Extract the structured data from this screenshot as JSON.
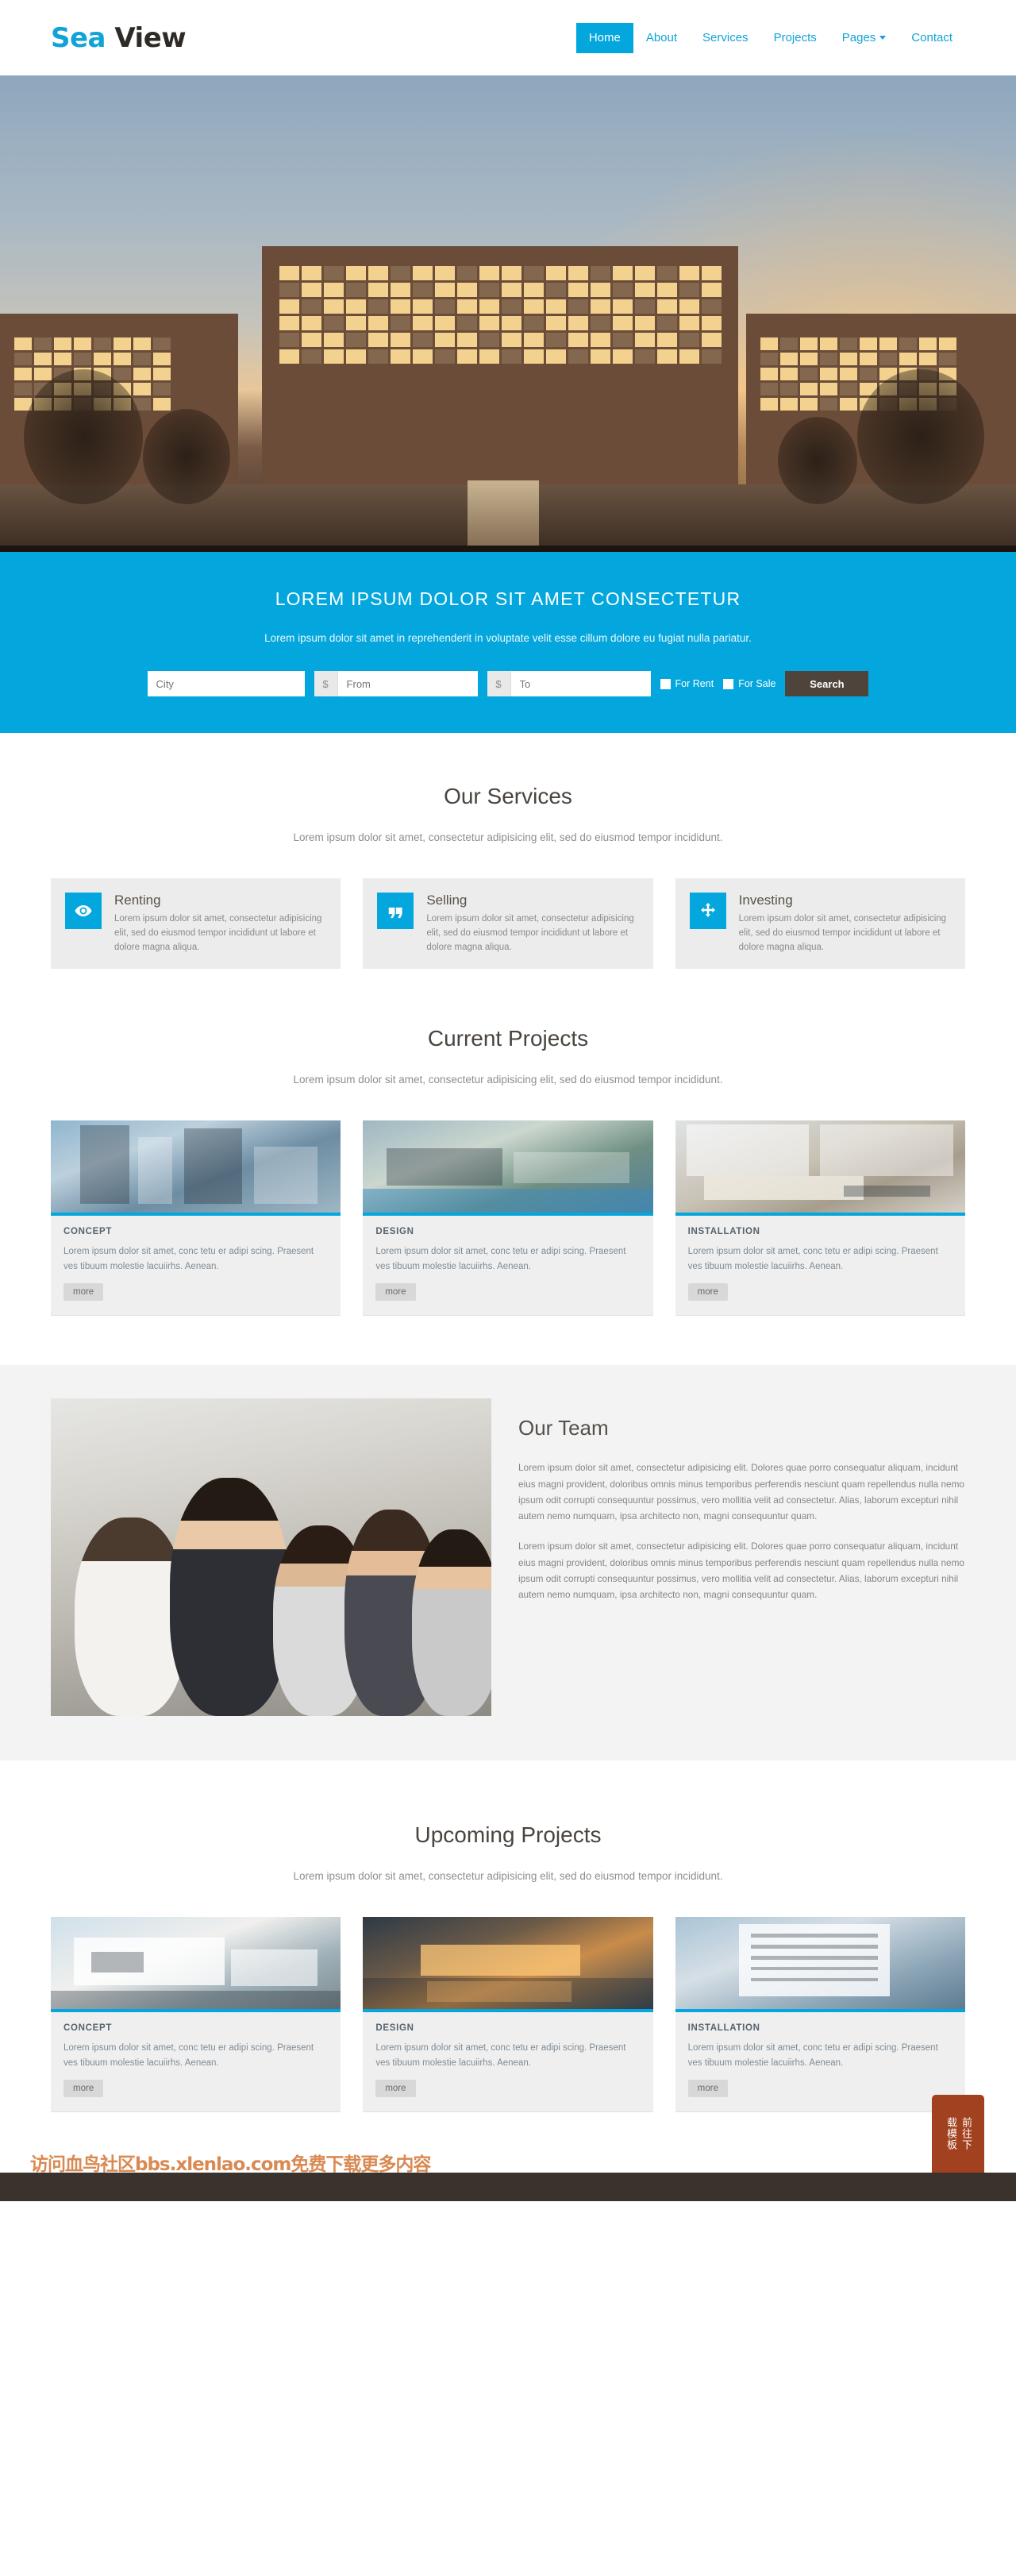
{
  "brand": {
    "first": "Sea",
    "second": "View"
  },
  "nav": {
    "items": [
      {
        "label": "Home",
        "active": true,
        "caret": false
      },
      {
        "label": "About",
        "active": false,
        "caret": false
      },
      {
        "label": "Services",
        "active": false,
        "caret": false
      },
      {
        "label": "Projects",
        "active": false,
        "caret": false
      },
      {
        "label": "Pages",
        "active": false,
        "caret": true
      },
      {
        "label": "Contact",
        "active": false,
        "caret": false
      }
    ]
  },
  "banner": {
    "title": "LOREM IPSUM DOLOR SIT AMET CONSECTETUR",
    "subtitle": "Lorem ipsum dolor sit amet in reprehenderit in voluptate velit esse cillum dolore eu fugiat nulla pariatur.",
    "city_placeholder": "City",
    "from_addon": "$",
    "from_placeholder": "From",
    "to_addon": "$",
    "to_placeholder": "To",
    "for_rent_label": "For Rent",
    "for_sale_label": "For Sale",
    "search_button": "Search",
    "accent_color": "#04a7dd",
    "search_button_color": "#4f443c"
  },
  "services": {
    "title": "Our Services",
    "subtitle": "Lorem ipsum dolor sit amet, consectetur adipisicing elit, sed do eiusmod tempor incididunt.",
    "cards": [
      {
        "icon": "eye-icon",
        "title": "Renting",
        "text": "Lorem ipsum dolor sit amet, consectetur adipisicing elit, sed do eiusmod tempor incididunt ut labore et dolore magna aliqua."
      },
      {
        "icon": "quote-icon",
        "title": "Selling",
        "text": "Lorem ipsum dolor sit amet, consectetur adipisicing elit, sed do eiusmod tempor incididunt ut labore et dolore magna aliqua."
      },
      {
        "icon": "move-arrows-icon",
        "title": "Investing",
        "text": "Lorem ipsum dolor sit amet, consectetur adipisicing elit, sed do eiusmod tempor incididunt ut labore et dolore magna aliqua."
      }
    ]
  },
  "current_projects": {
    "title": "Current Projects",
    "subtitle": "Lorem ipsum dolor sit amet, consectetur adipisicing elit, sed do eiusmod tempor incididunt.",
    "cards": [
      {
        "label": "CONCEPT",
        "text": "Lorem ipsum dolor sit amet, conc tetu er adipi scing. Praesent ves tibuum molestie lacuiirhs. Aenean.",
        "more": "more"
      },
      {
        "label": "DESIGN",
        "text": "Lorem ipsum dolor sit amet, conc tetu er adipi scing. Praesent ves tibuum molestie lacuiirhs. Aenean.",
        "more": "more"
      },
      {
        "label": "INSTALLATION",
        "text": "Lorem ipsum dolor sit amet, conc tetu er adipi scing. Praesent ves tibuum molestie lacuiirhs. Aenean.",
        "more": "more"
      }
    ]
  },
  "team": {
    "title": "Our Team",
    "paragraph1": "Lorem ipsum dolor sit amet, consectetur adipisicing elit. Dolores quae porro consequatur aliquam, incidunt eius magni provident, doloribus omnis minus temporibus perferendis nesciunt quam repellendus nulla nemo ipsum odit corrupti consequuntur possimus, vero mollitia velit ad consectetur. Alias, laborum excepturi nihil autem nemo numquam, ipsa architecto non, magni consequuntur quam.",
    "paragraph2": "Lorem ipsum dolor sit amet, consectetur adipisicing elit. Dolores quae porro consequatur aliquam, incidunt eius magni provident, doloribus omnis minus temporibus perferendis nesciunt quam repellendus nulla nemo ipsum odit corrupti consequuntur possimus, vero mollitia velit ad consectetur. Alias, laborum excepturi nihil autem nemo numquam, ipsa architecto non, magni consequuntur quam."
  },
  "upcoming_projects": {
    "title": "Upcoming Projects",
    "subtitle": "Lorem ipsum dolor sit amet, consectetur adipisicing elit, sed do eiusmod tempor incididunt.",
    "cards": [
      {
        "label": "CONCEPT",
        "text": "Lorem ipsum dolor sit amet, conc tetu er adipi scing. Praesent ves tibuum molestie lacuiirhs. Aenean.",
        "more": "more"
      },
      {
        "label": "DESIGN",
        "text": "Lorem ipsum dolor sit amet, conc tetu er adipi scing. Praesent ves tibuum molestie lacuiirhs. Aenean.",
        "more": "more"
      },
      {
        "label": "INSTALLATION",
        "text": "Lorem ipsum dolor sit amet, conc tetu er adipi scing. Praesent ves tibuum molestie lacuiirhs. Aenean.",
        "more": "more"
      }
    ]
  },
  "overlay": {
    "download_button": "前往下载模板",
    "watermark": "访问血鸟社区bbs.xlenlao.com免费下载更多内容",
    "download_button_color": "#a2411f",
    "watermark_color": "#d98a52"
  }
}
